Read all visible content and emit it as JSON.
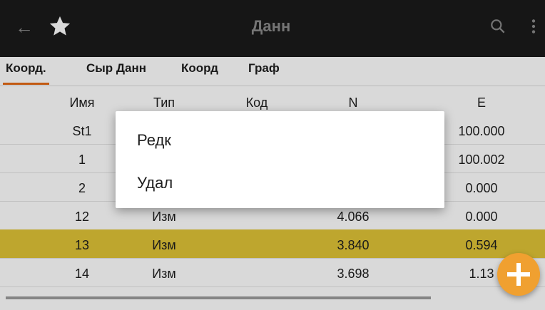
{
  "appbar": {
    "title": "Данн",
    "icons": [
      "back-arrow-icon",
      "star-icon",
      "search-icon",
      "more-vert-icon"
    ]
  },
  "tabs": [
    {
      "label": "Коорд.",
      "active": true
    },
    {
      "label": "Сыр Данн",
      "active": false
    },
    {
      "label": "Коорд",
      "active": false
    },
    {
      "label": "Граф",
      "active": false
    }
  ],
  "table": {
    "headers": [
      "Имя",
      "Тип",
      "Код",
      "N",
      "E"
    ],
    "rows": [
      {
        "name": "St1",
        "type": "",
        "code": "",
        "n": "",
        "e": "100.000",
        "selected": false
      },
      {
        "name": "1",
        "type": "",
        "code": "",
        "n": "",
        "e": "100.002",
        "selected": false
      },
      {
        "name": "2",
        "type": "",
        "code": "",
        "n": "",
        "e": "0.000",
        "selected": false
      },
      {
        "name": "12",
        "type": "Изм",
        "code": "",
        "n": "4.066",
        "e": "0.000",
        "selected": false
      },
      {
        "name": "13",
        "type": "Изм",
        "code": "",
        "n": "3.840",
        "e": "0.594",
        "selected": true
      },
      {
        "name": "14",
        "type": "Изм",
        "code": "",
        "n": "3.698",
        "e": "1.13",
        "selected": false
      }
    ]
  },
  "dialog": {
    "items": [
      "Редк",
      "Удал"
    ]
  },
  "fab": {
    "label": "+"
  },
  "colors": {
    "accent": "#e46a16",
    "selected_row": "#e0c437",
    "fab": "#f0a030",
    "appbar": "#1b1b1b"
  }
}
